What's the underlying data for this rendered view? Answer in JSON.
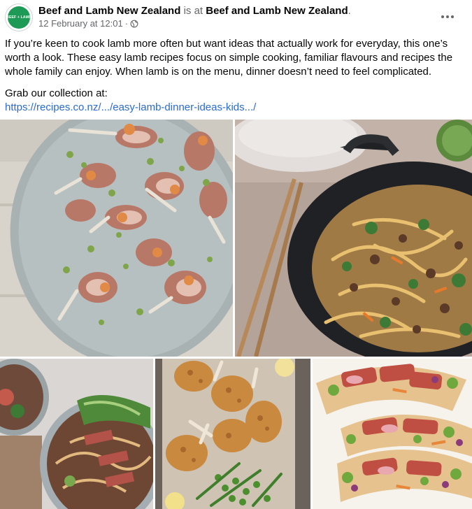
{
  "post": {
    "author": "Beef and Lamb New Zealand",
    "is_at": "is at",
    "location": "Beef and Lamb New Zealand",
    "location_suffix": ".",
    "timestamp": "12 February at 12:01",
    "separator": "·",
    "privacy_icon": "globe-icon",
    "more_icon": "more-options-icon",
    "avatar_text": "BEEF + LAMB"
  },
  "caption": {
    "paragraph1": "If you’re keen to cook lamb more often but want ideas that actually work for everyday, this one’s worth a look. These easy lamb recipes focus on simple cooking, familiar flavours and recipes the whole family can enjoy. When lamb is on the menu, dinner doesn’t need to feel complicated.",
    "paragraph2": "Grab our collection at:",
    "link": "https://recipes.co.nz/.../easy-lamb-dinner-ideas-kids.../"
  },
  "photos": [
    {
      "name": "photo-lamb-cutlets-platter"
    },
    {
      "name": "photo-lamb-noodle-wok"
    },
    {
      "name": "photo-lamb-noodle-bowl"
    },
    {
      "name": "photo-crumbed-lamb-cutlets"
    },
    {
      "name": "photo-lamb-tacos"
    }
  ],
  "colors": {
    "brand_green": "#1d9a55",
    "link_blue": "#2a6bd1",
    "meta_grey": "#65676b"
  }
}
